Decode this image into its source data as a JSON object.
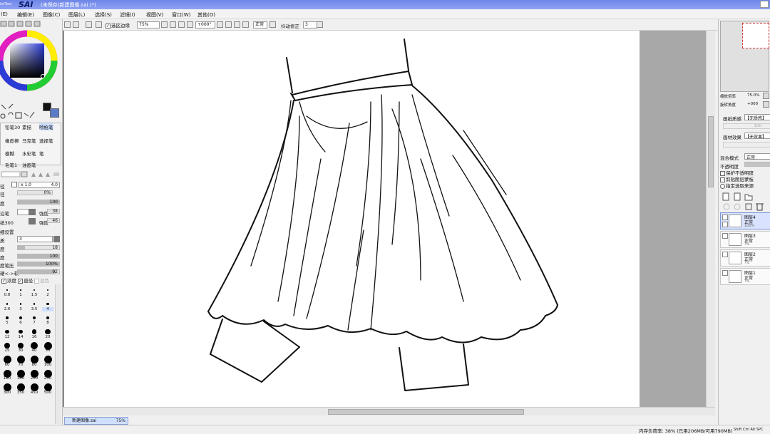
{
  "app": {
    "logo": "SAI",
    "logo_prefix": "intTool",
    "title": "(未保存)新建图像.sai (*)"
  },
  "menu": [
    {
      "label": "(E)"
    },
    {
      "label": "编辑(E)"
    },
    {
      "label": "图像(C)"
    },
    {
      "label": "图层(L)"
    },
    {
      "label": "选择(S)"
    },
    {
      "label": "滤镜(I)"
    },
    {
      "label": "视图(V)"
    },
    {
      "label": "窗口(W)"
    },
    {
      "label": "其他(O)"
    }
  ],
  "toolbar": {
    "selection_edge_label": "选区边缘",
    "zoom": "75%",
    "rotation": "+000°",
    "mode": "正常",
    "stabilizer_label": "抖动修正",
    "stabilizer_value": "3"
  },
  "colors": {
    "primary": "#121212",
    "secondary": "#5b7bc7",
    "accent": "#6f86e8"
  },
  "tools": {
    "row1": [
      "铅笔30",
      "素描",
      "喷枪笔"
    ],
    "row2": [
      "橡皮擦",
      "马克笔",
      "选择笔"
    ],
    "row3": [
      "模糊",
      "水彩笔",
      "笔"
    ],
    "row4": [
      "毛笔1",
      "油画笔"
    ]
  },
  "brush": {
    "size_label": "径",
    "size_mult": "x 1.0",
    "size_value": "4.0",
    "min_size_label": "径",
    "min_size_value": "0%",
    "density_label": "度",
    "density_value": "100",
    "shape_label": "沿笔",
    "shape_strength_label": "强度",
    "shape_strength_value": "38",
    "texture_label": "纸300",
    "texture_strength_label": "强度",
    "texture_strength_value": "46",
    "adv_title": "细设置",
    "quality_label": "质",
    "quality_value": "3",
    "edge_label": "度",
    "edge_value": "18",
    "min_density_label": "度",
    "min_density_value": "100",
    "pressure_label": "度笔压",
    "pressure_value": "100%",
    "hard_soft_label": "硬<->软",
    "hard_soft_value": "92",
    "density_chk": "浓度",
    "size_chk": "直径",
    "blend_chk": "混色"
  },
  "brush_sizes": [
    "0.8",
    "1",
    "1.5",
    "2",
    "2.6",
    "3",
    "3.5",
    "4",
    "5",
    "6",
    "7",
    "8",
    "12",
    "14",
    "16",
    "20",
    "25",
    "30",
    "40",
    "50",
    "60",
    "70",
    "80",
    "100",
    "120",
    "160",
    "200",
    "250",
    "300",
    "350",
    "450",
    "500"
  ],
  "right": {
    "zoom_label": "缩放倍率",
    "zoom_value": "75.0%",
    "rotate_label": "旋转角度",
    "rotate_value": "+000",
    "paper_label": "画纸质感",
    "paper_value": "【无质感】",
    "paper_mult": "100",
    "effect_label": "画材效果",
    "effect_value": "【无效果】",
    "blend_label": "混合模式",
    "blend_value": "正常",
    "opacity_label": "不透明度",
    "opt1": "保护不透明度",
    "opt2": "剪贴图层蒙板",
    "opt3": "指定选取来源"
  },
  "layers": [
    {
      "name": "图层4",
      "mode": "正常",
      "opacity": "100%"
    },
    {
      "name": "图层3",
      "mode": "正常",
      "opacity": "?%"
    },
    {
      "name": "图层2",
      "mode": "正常",
      "opacity": "?%"
    },
    {
      "name": "图层1",
      "mode": "正常",
      "opacity": "?%"
    }
  ],
  "doc_tab": {
    "name": "新建图像.sai",
    "zoom": "75%"
  },
  "status": {
    "text": "内存负荷率: 38% (已用206MB/可用790MB)",
    "keys": "Shift Ctrl Alt SPC"
  }
}
